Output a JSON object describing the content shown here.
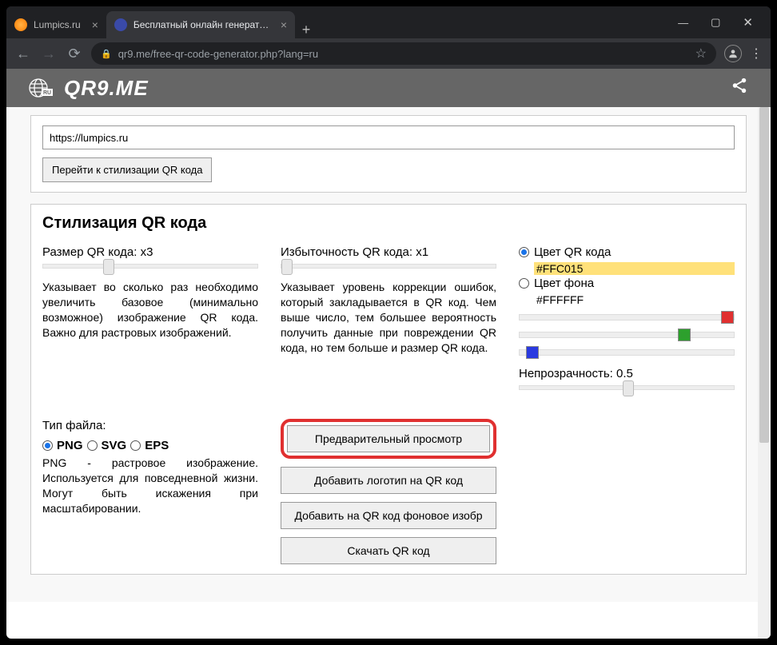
{
  "browser": {
    "tabs": [
      {
        "label": "Lumpics.ru",
        "active": false
      },
      {
        "label": "Бесплатный онлайн генератор Q",
        "active": true
      }
    ],
    "url": "qr9.me/free-qr-code-generator.php?lang=ru"
  },
  "site": {
    "logo": "QR9.ME",
    "lang_badge": "RU"
  },
  "panel1": {
    "url_value": "https://lumpics.ru",
    "button": "Перейти к стилизации QR кода"
  },
  "panel2": {
    "title": "Стилизация QR кода",
    "size": {
      "label": "Размер QR кода: x3",
      "desc": "Указывает во сколько раз необходимо увеличить базовое (минимально возможное) изображение QR кода. Важно для растровых изображений."
    },
    "redundancy": {
      "label": "Избыточность QR кода: x1",
      "desc": "Указывает уровень коррекции ошибок, который закладывается в QR код. Чем выше число, тем большее вероятность получить данные при повреждении QR кода, но тем больше и размер QR кода."
    },
    "colors": {
      "qr_label": "Цвет QR кода",
      "qr_hex": "#FFC015",
      "bg_label": "Цвет фона",
      "bg_hex": "#FFFFFF",
      "opacity_label": "Непрозрачность: 0.5"
    },
    "filetype": {
      "label": "Тип файла:",
      "opts": [
        "PNG",
        "SVG",
        "EPS"
      ],
      "desc": "PNG - растровое изображение. Используется для повседневной жизни. Могут быть искажения при масштабировании."
    },
    "buttons": {
      "preview": "Предварительный просмотр",
      "logo": "Добавить логотип на QR код",
      "bg": "Добавить на QR код фоновое изобр",
      "download": "Скачать QR код"
    }
  }
}
